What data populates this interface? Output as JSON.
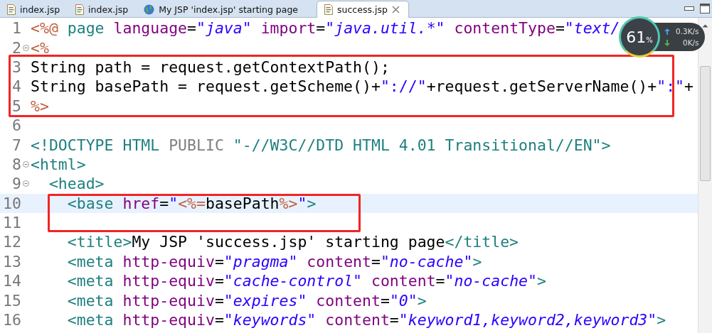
{
  "tabs": [
    {
      "label": "index.jsp",
      "kind": "file",
      "selected": false
    },
    {
      "label": "index.jsp",
      "kind": "file",
      "selected": false
    },
    {
      "label": "My JSP 'index.jsp' starting page",
      "kind": "web",
      "selected": false
    },
    {
      "label": "success.jsp",
      "kind": "file",
      "selected": true
    }
  ],
  "editor": {
    "lines": [
      {
        "number": "1",
        "foldable": false,
        "current": false,
        "tokens": [
          {
            "text": "<%@ ",
            "kind": "jsp"
          },
          {
            "text": "page ",
            "kind": "tag"
          },
          {
            "text": "language",
            "kind": "attr"
          },
          {
            "text": "=",
            "kind": "plain"
          },
          {
            "text": "\"java\" ",
            "kind": "val"
          },
          {
            "text": "import",
            "kind": "attr"
          },
          {
            "text": "=",
            "kind": "plain"
          },
          {
            "text": "\"java.util.*\" ",
            "kind": "val"
          },
          {
            "text": "contentType",
            "kind": "attr"
          },
          {
            "text": "=",
            "kind": "plain"
          },
          {
            "text": "\"text/",
            "kind": "val"
          }
        ]
      },
      {
        "number": "2",
        "foldable": true,
        "current": false,
        "tokens": [
          {
            "text": "<%",
            "kind": "jsp"
          }
        ]
      },
      {
        "number": "3",
        "foldable": false,
        "current": false,
        "tokens": [
          {
            "text": "String path = request.getContextPath();",
            "kind": "plain"
          }
        ]
      },
      {
        "number": "4",
        "foldable": false,
        "current": false,
        "tokens": [
          {
            "text": "String basePath = request.getScheme()+",
            "kind": "plain"
          },
          {
            "text": "\"://\"",
            "kind": "str"
          },
          {
            "text": "+request.getServerName()+",
            "kind": "plain"
          },
          {
            "text": "\":\"",
            "kind": "str"
          },
          {
            "text": "+",
            "kind": "plain"
          }
        ]
      },
      {
        "number": "5",
        "foldable": false,
        "current": false,
        "tokens": [
          {
            "text": "%>",
            "kind": "jsp"
          }
        ]
      },
      {
        "number": "6",
        "foldable": false,
        "current": false
      },
      {
        "number": "7",
        "foldable": false,
        "current": false,
        "tokens": [
          {
            "text": "<!DOCTYPE HTML ",
            "kind": "tag"
          },
          {
            "text": "PUBLIC ",
            "kind": "gray"
          },
          {
            "text": "\"-//W3C//DTD HTML 4.01 Transitional//EN\">",
            "kind": "tag"
          }
        ]
      },
      {
        "number": "8",
        "foldable": true,
        "current": false,
        "tokens": [
          {
            "text": "<html>",
            "kind": "tag"
          }
        ]
      },
      {
        "number": "9",
        "foldable": true,
        "current": false,
        "tokens": [
          {
            "text": "  <head>",
            "kind": "tag"
          }
        ]
      },
      {
        "number": "10",
        "foldable": false,
        "current": true,
        "tokens": [
          {
            "text": "    <base ",
            "kind": "tag"
          },
          {
            "text": "href",
            "kind": "attr"
          },
          {
            "text": "=",
            "kind": "plain"
          },
          {
            "text": "\"",
            "kind": "str"
          },
          {
            "text": "<%=",
            "kind": "jsp"
          },
          {
            "text": "basePath",
            "kind": "plain"
          },
          {
            "text": "%>",
            "kind": "jsp"
          },
          {
            "text": "\"",
            "kind": "str"
          },
          {
            "text": ">",
            "kind": "tag"
          }
        ]
      },
      {
        "number": "11",
        "foldable": false,
        "current": false
      },
      {
        "number": "12",
        "foldable": false,
        "current": false,
        "tokens": [
          {
            "text": "    <title>",
            "kind": "tag"
          },
          {
            "text": "My JSP 'success.jsp' starting page",
            "kind": "plain"
          },
          {
            "text": "</title>",
            "kind": "tag"
          }
        ]
      },
      {
        "number": "13",
        "foldable": false,
        "current": false,
        "tokens": [
          {
            "text": "    <meta ",
            "kind": "tag"
          },
          {
            "text": "http-equiv",
            "kind": "attr"
          },
          {
            "text": "=",
            "kind": "plain"
          },
          {
            "text": "\"pragma\" ",
            "kind": "val"
          },
          {
            "text": "content",
            "kind": "attr"
          },
          {
            "text": "=",
            "kind": "plain"
          },
          {
            "text": "\"no-cache\"",
            "kind": "val"
          },
          {
            "text": ">",
            "kind": "tag"
          }
        ]
      },
      {
        "number": "14",
        "foldable": false,
        "current": false,
        "tokens": [
          {
            "text": "    <meta ",
            "kind": "tag"
          },
          {
            "text": "http-equiv",
            "kind": "attr"
          },
          {
            "text": "=",
            "kind": "plain"
          },
          {
            "text": "\"cache-control\" ",
            "kind": "val"
          },
          {
            "text": "content",
            "kind": "attr"
          },
          {
            "text": "=",
            "kind": "plain"
          },
          {
            "text": "\"no-cache\"",
            "kind": "val"
          },
          {
            "text": ">",
            "kind": "tag"
          }
        ]
      },
      {
        "number": "15",
        "foldable": false,
        "current": false,
        "tokens": [
          {
            "text": "    <meta ",
            "kind": "tag"
          },
          {
            "text": "http-equiv",
            "kind": "attr"
          },
          {
            "text": "=",
            "kind": "plain"
          },
          {
            "text": "\"expires\" ",
            "kind": "val"
          },
          {
            "text": "content",
            "kind": "attr"
          },
          {
            "text": "=",
            "kind": "plain"
          },
          {
            "text": "\"0\"",
            "kind": "val"
          },
          {
            "text": ">",
            "kind": "tag"
          }
        ]
      },
      {
        "number": "16",
        "foldable": false,
        "current": false,
        "tokens": [
          {
            "text": "    <meta ",
            "kind": "tag"
          },
          {
            "text": "http-equiv",
            "kind": "attr"
          },
          {
            "text": "=",
            "kind": "plain"
          },
          {
            "text": "\"keywords\" ",
            "kind": "val"
          },
          {
            "text": "content",
            "kind": "attr"
          },
          {
            "text": "=",
            "kind": "plain"
          },
          {
            "text": "\"keyword1,keyword2,keyword3\"",
            "kind": "val"
          },
          {
            "text": ">",
            "kind": "tag"
          }
        ]
      }
    ]
  },
  "network_widget": {
    "percent": "61",
    "percent_sign": "%",
    "upload": "0.3K/s",
    "download": "0K/s"
  }
}
